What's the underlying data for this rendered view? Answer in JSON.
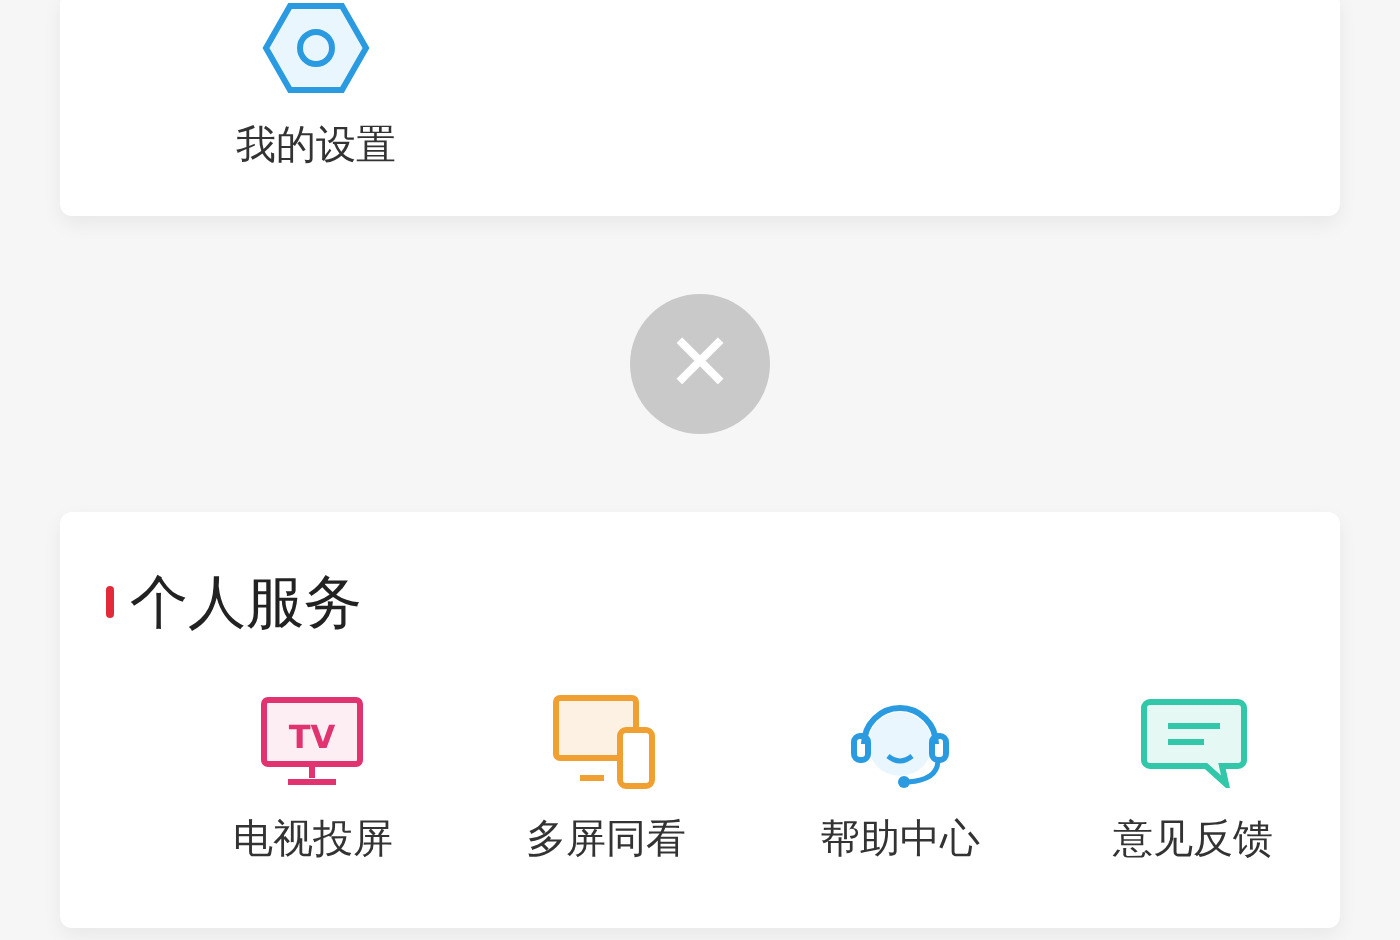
{
  "settings_card": {
    "items": [
      {
        "kind": "settings",
        "label": "我的设置"
      }
    ]
  },
  "close_button": {
    "glyph": "✕"
  },
  "personal_services": {
    "title": "个人服务",
    "items": [
      {
        "kind": "tv",
        "label": "电视投屏",
        "icon_text": "TV"
      },
      {
        "kind": "devices",
        "label": "多屏同看"
      },
      {
        "kind": "headset",
        "label": "帮助中心"
      },
      {
        "kind": "chat",
        "label": "意见反馈"
      }
    ]
  }
}
